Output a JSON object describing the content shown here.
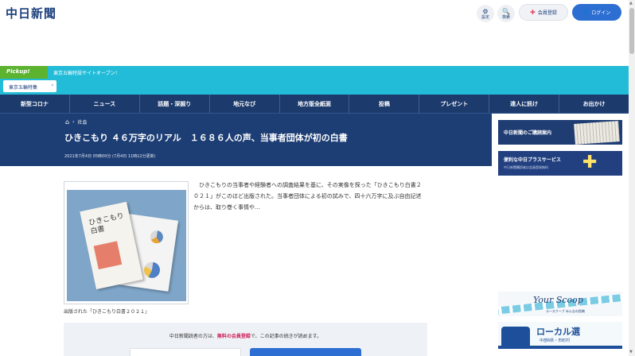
{
  "header": {
    "logo": "中日新聞",
    "settings": {
      "icon": "gear-icon",
      "glyph": "⚙",
      "label": "設定"
    },
    "search": {
      "icon": "search-icon",
      "glyph": "🔍",
      "label": "検索"
    },
    "member_label": "会員登録",
    "login_label": "ログイン"
  },
  "pickup": {
    "tag": "Pickup!",
    "text": "東京五輪特設サイトオープン！",
    "button_label": "東京五輪特集"
  },
  "nav": {
    "items": [
      "新型コロナ",
      "ニュース",
      "話題・深掘り",
      "地元なび",
      "地方版全紙面",
      "投稿",
      "プレゼント",
      "達人に訊け",
      "お出かけ"
    ]
  },
  "article": {
    "breadcrumb": [
      "社会"
    ],
    "headline": "ひきこもり ４６万字のリアル　１６８６人の声、当事者団体が初の白書",
    "dateline": "2021年7月4日 05時00分 (7月4日 11時12分更新)",
    "photo_book_title": [
      "ひきこもり",
      "白書"
    ],
    "caption": "出版された「ひきこもり白書２０２１」",
    "lead": "　ひきこもりの当事者や経験者への調査結果を基に、その実像を探った「ひきこもり白書２０２１」がこのほど出版された。当事者団体による初の試みで、四十六万字に及ぶ自由記述からは、取り巻く事情や…"
  },
  "paywall": {
    "prefix": "中日新聞読者の方は、",
    "highlight": "無料の会員登録",
    "suffix": "で、この記事の続きが読めます。"
  },
  "sidebar": {
    "banner1": "中日新聞のご購読案内",
    "banner2_title": "便利な中日プラスサービス",
    "banner2_sub": "中日新聞購読者は会員登録無料",
    "ad1_brand": "Your Scoop",
    "ad1_sub": "ユースクープ みんなの投稿",
    "ad2_brand": "ローカル選",
    "ad2_sub": "中部6県・市町村"
  },
  "colors": {
    "navy": "#1c3a6c",
    "accent_blue": "#2d6ed2",
    "pickup_cyan": "#23bcd8",
    "pickup_green": "#5bb330",
    "highlight_red": "#d0245a"
  }
}
